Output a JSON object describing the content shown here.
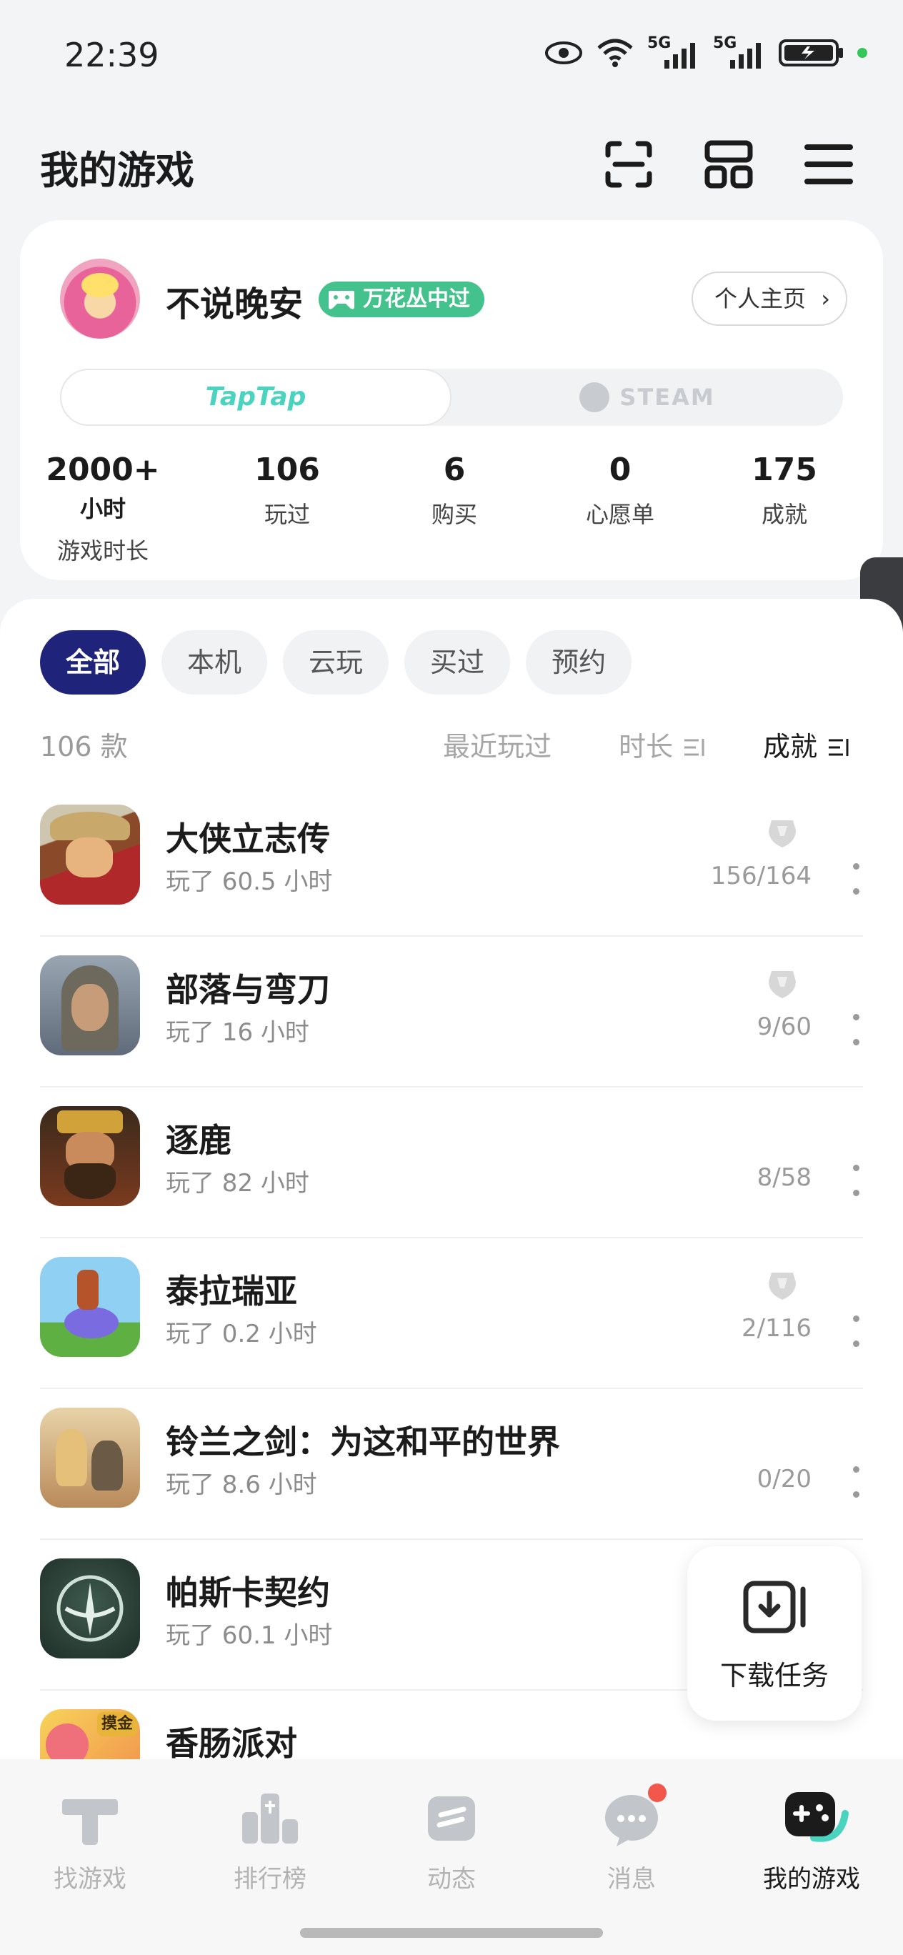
{
  "status_bar": {
    "time": "22:39",
    "signal1": "5G",
    "signal2": "5G"
  },
  "header": {
    "title": "我的游戏"
  },
  "profile": {
    "username": "不说晚安",
    "badge": "万花丛中过",
    "homepage_label": "个人主页",
    "platforms": [
      "TapTap",
      "STEAM"
    ],
    "stats": [
      {
        "value": "2000+",
        "unit": "小时",
        "label": "游戏时长"
      },
      {
        "value": "106",
        "unit": "",
        "label": "玩过"
      },
      {
        "value": "6",
        "unit": "",
        "label": "购买"
      },
      {
        "value": "0",
        "unit": "",
        "label": "心愿单"
      },
      {
        "value": "175",
        "unit": "",
        "label": "成就"
      }
    ]
  },
  "filters": [
    "全部",
    "本机",
    "云玩",
    "买过",
    "预约"
  ],
  "list_header": {
    "count": "106 款",
    "sort_recent": "最近玩过",
    "sort_duration": "时长",
    "sort_achievement": "成就"
  },
  "games": [
    {
      "name": "大侠立志传",
      "played": "玩了 60.5 小时",
      "achievements": "156/164",
      "trophy": true
    },
    {
      "name": "部落与弯刀",
      "played": "玩了 16 小时",
      "achievements": "9/60",
      "trophy": true
    },
    {
      "name": "逐鹿",
      "played": "玩了 82 小时",
      "achievements": "8/58",
      "trophy": false
    },
    {
      "name": "泰拉瑞亚",
      "played": "玩了 0.2 小时",
      "achievements": "2/116",
      "trophy": true
    },
    {
      "name": "铃兰之剑：为这和平的世界",
      "played": "玩了 8.6 小时",
      "achievements": "0/20",
      "trophy": false
    },
    {
      "name": "帕斯卡契约",
      "played": "玩了 60.1 小时",
      "achievements": "",
      "trophy": false
    },
    {
      "name": "香肠派对",
      "played": "",
      "achievements": "",
      "trophy": false,
      "icon_tag": "摸金"
    }
  ],
  "download_task": {
    "label": "下载任务"
  },
  "bottom_nav": [
    {
      "label": "找游戏",
      "icon": "find-games-icon"
    },
    {
      "label": "排行榜",
      "icon": "ranking-icon"
    },
    {
      "label": "动态",
      "icon": "feed-icon"
    },
    {
      "label": "消息",
      "icon": "message-icon"
    },
    {
      "label": "我的游戏",
      "icon": "my-games-icon"
    }
  ],
  "colors": {
    "accent": "#1f237a",
    "taptap": "#4ad3bf",
    "badge": "#43c28d",
    "notification": "#f2574b"
  }
}
